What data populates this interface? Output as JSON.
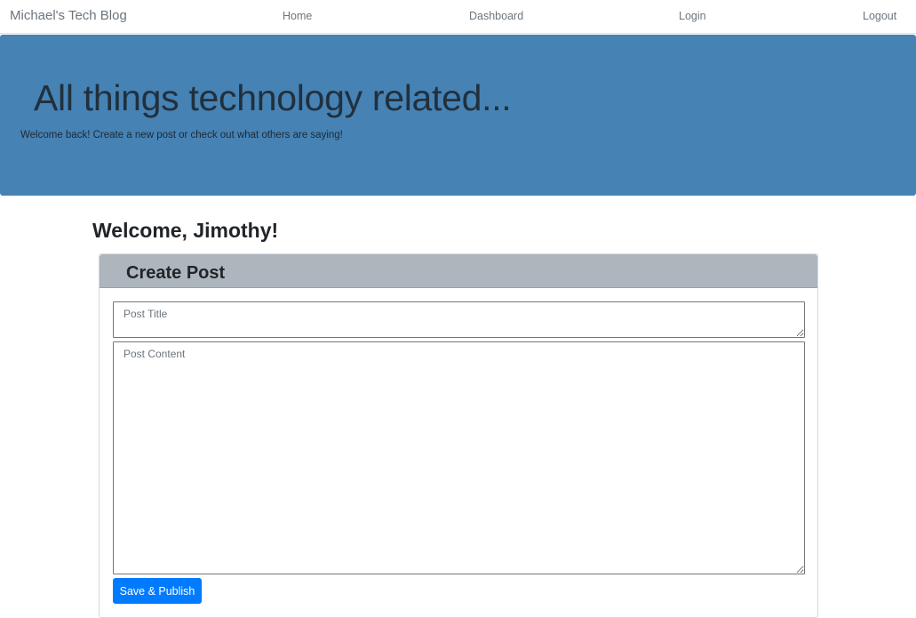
{
  "navbar": {
    "brand": "Michael's Tech Blog",
    "links": [
      {
        "label": "Home"
      },
      {
        "label": "Dashboard"
      },
      {
        "label": "Login"
      },
      {
        "label": "Logout"
      }
    ]
  },
  "hero": {
    "title": "All things technology related...",
    "subtitle": "Welcome back! Create a new post or check out what others are saying!",
    "background_color": "#4682b4"
  },
  "welcome": {
    "text": "Welcome, Jimothy!"
  },
  "create_post": {
    "header": "Create Post",
    "header_color": "#adb5bd",
    "title_field": {
      "placeholder": "Post Title",
      "value": ""
    },
    "content_field": {
      "placeholder": "Post Content",
      "value": ""
    },
    "submit_label": "Save & Publish",
    "submit_color": "#007bff"
  }
}
